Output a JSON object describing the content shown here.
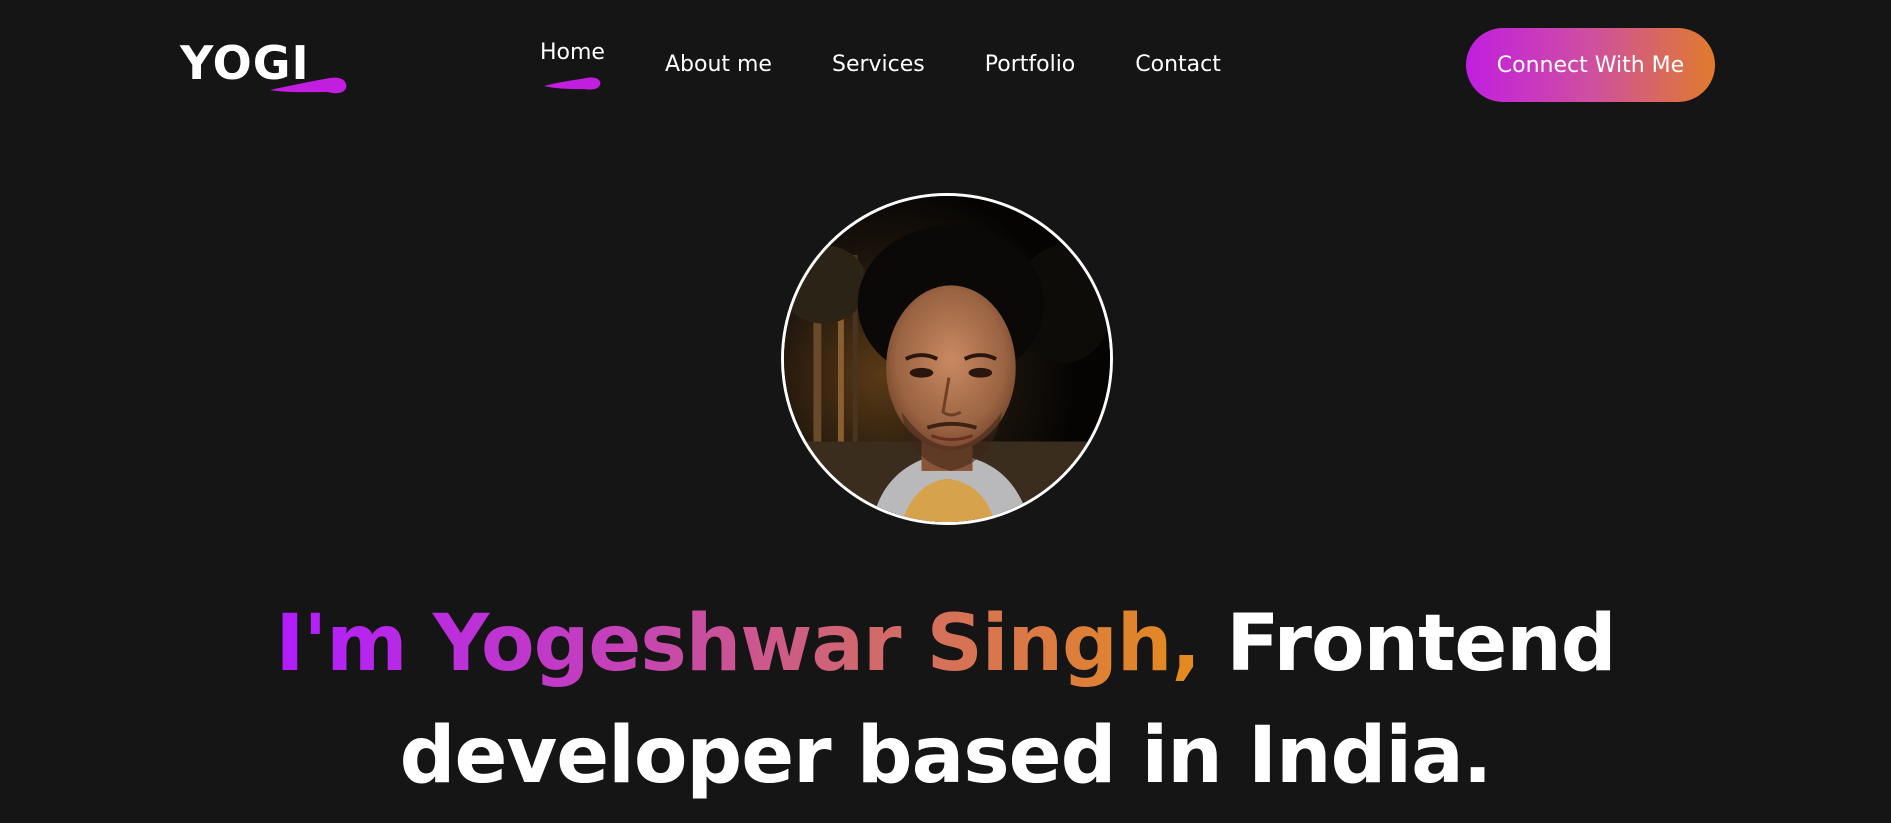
{
  "logo": {
    "text": "YOGI",
    "accent_color": "#c11ee0"
  },
  "nav": {
    "items": [
      {
        "label": "Home",
        "active": true
      },
      {
        "label": "About me",
        "active": false
      },
      {
        "label": "Services",
        "active": false
      },
      {
        "label": "Portfolio",
        "active": false
      },
      {
        "label": "Contact",
        "active": false
      }
    ]
  },
  "cta": {
    "label": "Connect With Me",
    "gradient_start": "#c11ee0",
    "gradient_end": "#e07b2c"
  },
  "hero": {
    "avatar_alt": "profile-photo",
    "headline_highlight": "I'm Yogeshwar Singh,",
    "headline_rest_line1": " Frontend",
    "headline_line2": "developer based in India."
  },
  "colors": {
    "background": "#161515",
    "text": "#ffffff"
  }
}
